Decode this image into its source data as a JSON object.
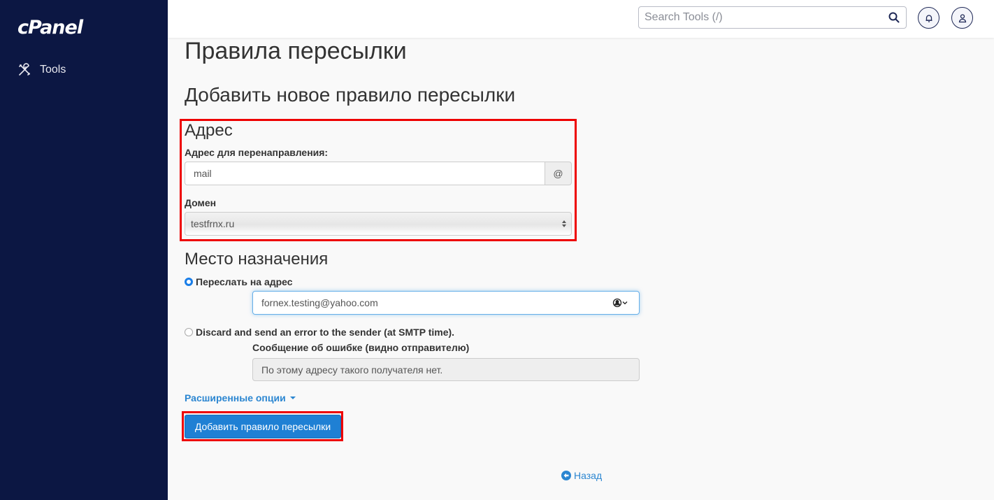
{
  "sidebar": {
    "logo": "cPanel",
    "items": [
      {
        "label": "Tools",
        "icon": "tools-icon"
      }
    ]
  },
  "topbar": {
    "search_placeholder": "Search Tools (/)",
    "notifications_icon": "bell-icon",
    "user_icon": "user-icon"
  },
  "page": {
    "title": "Правила пересылки",
    "subtitle": "Добавить новое правило пересылки"
  },
  "address_section": {
    "heading": "Адрес",
    "forward_label": "Адрес для перенаправления:",
    "forward_value": "mail",
    "at_addon": "@",
    "domain_label": "Домен",
    "domain_selected": "testfrnx.ru"
  },
  "destination_section": {
    "heading": "Место назначения",
    "options": [
      {
        "label": "Переслать на адрес",
        "selected": true
      },
      {
        "label": "Discard and send an error to the sender (at SMTP time).",
        "selected": false
      }
    ],
    "forward_to_value": "fornex.testing@yahoo.com",
    "error_label": "Сообщение об ошибке (видно отправителю)",
    "error_value": "По этому адресу такого получателя нет."
  },
  "advanced_options_label": "Расширенные опции",
  "submit_label": "Добавить правило пересылки",
  "back_label": "Назад",
  "colors": {
    "sidebar_bg": "#0c1743",
    "accent": "#1f80d4",
    "highlight": "#ee0000"
  }
}
